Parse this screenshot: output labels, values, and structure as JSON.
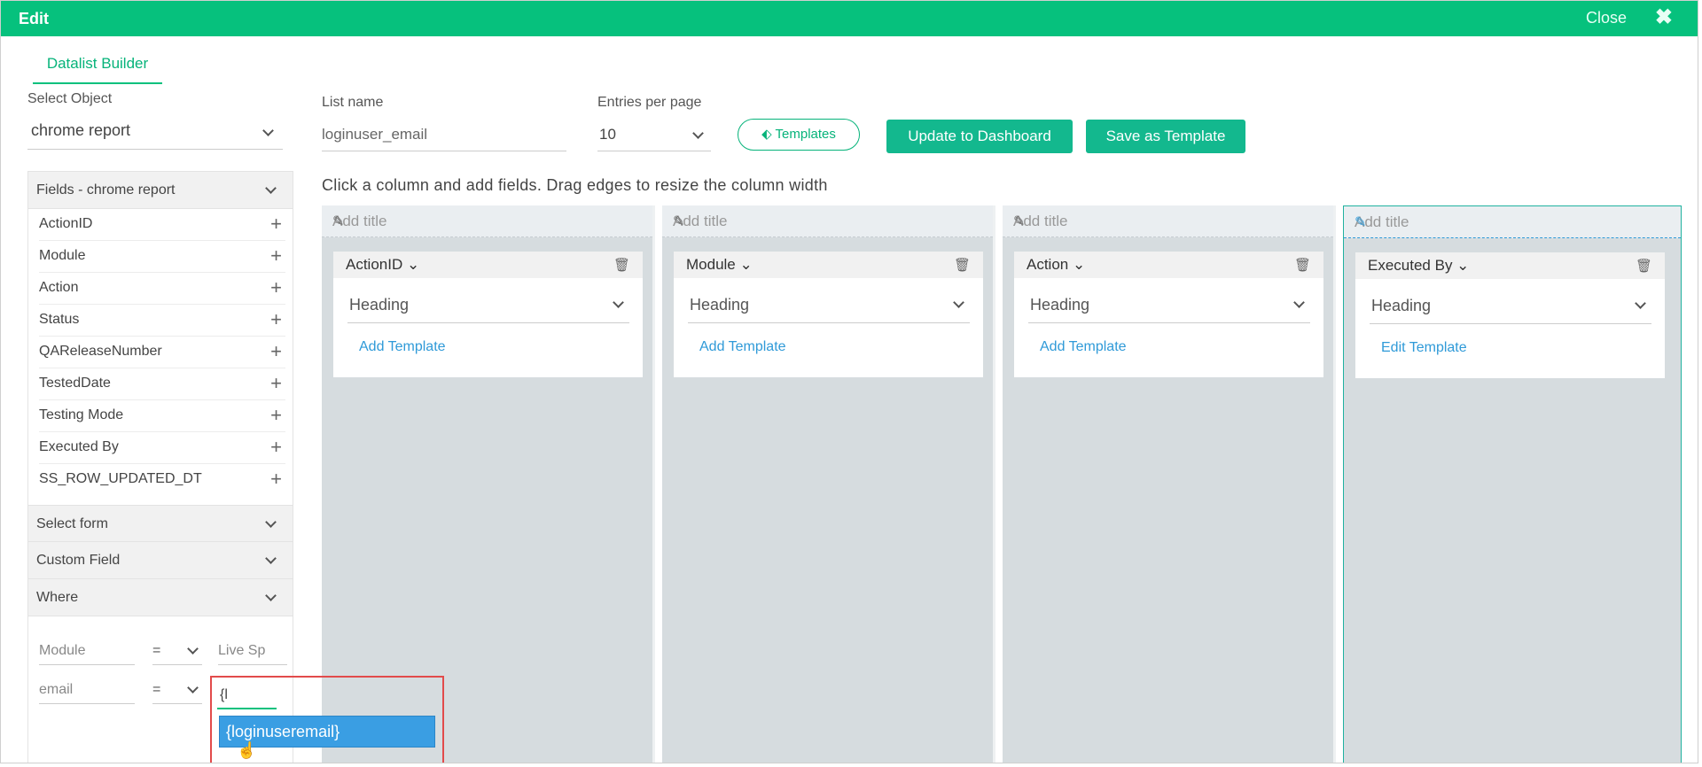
{
  "header": {
    "title": "Edit",
    "close_label": "Close",
    "close_icon": "✖"
  },
  "tabs": [
    {
      "label": "Datalist Builder",
      "active": true
    }
  ],
  "select_object": {
    "label": "Select Object",
    "value": "chrome report"
  },
  "list_name": {
    "label": "List name",
    "value": "loginuser_email"
  },
  "entries_per_page": {
    "label": "Entries per page",
    "value": "10"
  },
  "buttons": {
    "templates": "Templates",
    "update_dashboard": "Update to Dashboard",
    "save_template": "Save as Template"
  },
  "hint": "Click a column and add fields. Drag edges to resize the column width",
  "fields_panel": {
    "title": "Fields - chrome report",
    "items": [
      "ActionID",
      "Module",
      "Action",
      "Status",
      "QAReleaseNumber",
      "TestedDate",
      "Testing Mode",
      "Executed By",
      "SS_ROW_UPDATED_DT"
    ]
  },
  "sections": {
    "select_form": "Select form",
    "custom_field": "Custom Field",
    "where": "Where"
  },
  "where": {
    "rows": [
      {
        "field": "Module",
        "op": "=",
        "value": "Live Sp"
      },
      {
        "field": "email",
        "op": "=",
        "value": "{l"
      }
    ],
    "suggestion": "{loginuseremail}"
  },
  "columns": [
    {
      "title_placeholder": "Add title",
      "field": "ActionID",
      "heading": "Heading",
      "template_link": "Add Template"
    },
    {
      "title_placeholder": "Add title",
      "field": "Module",
      "heading": "Heading",
      "template_link": "Add Template"
    },
    {
      "title_placeholder": "Add title",
      "field": "Action",
      "heading": "Heading",
      "template_link": "Add Template"
    },
    {
      "title_placeholder": "Add title",
      "field": "Executed By",
      "heading": "Heading",
      "template_link": "Edit Template"
    }
  ],
  "colors": {
    "header_bg": "#06c17d",
    "button_bg": "#13b88e",
    "link": "#2f9ad8",
    "highlight_border": "#e24b4b",
    "suggestion_bg": "#3a9ee3"
  }
}
